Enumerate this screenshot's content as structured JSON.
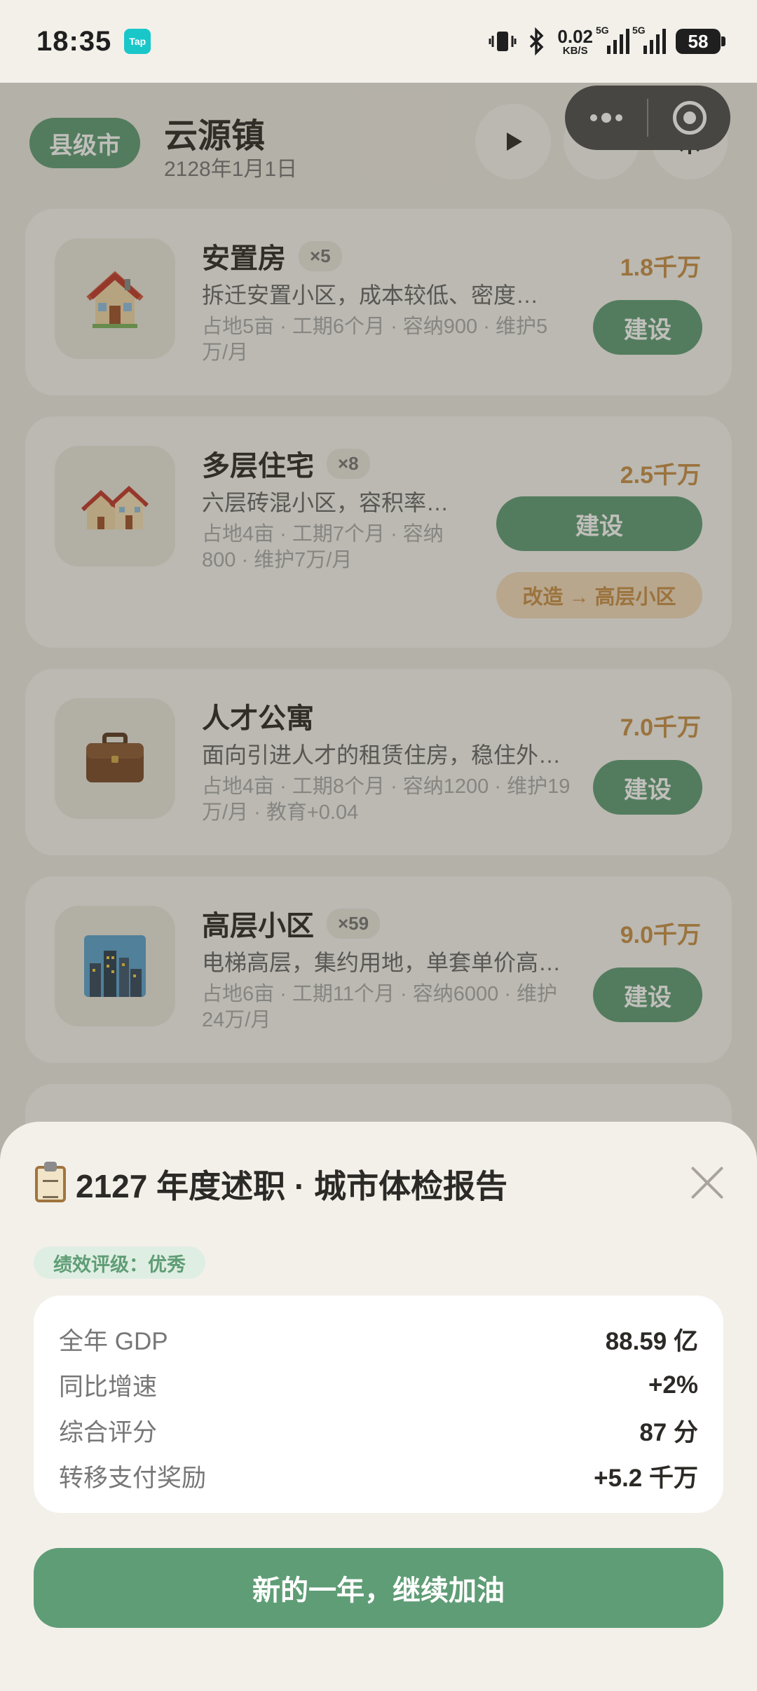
{
  "status_bar": {
    "time": "18:35",
    "app_badge": "Tap",
    "net_speed": "0.02",
    "net_unit": "KB/S",
    "sim1": "5G",
    "sim2": "5G",
    "battery": "58"
  },
  "header": {
    "level": "县级市",
    "town": "云源镇",
    "date": "2128年1月1日",
    "play_icon": "play-icon",
    "speed": "4x",
    "settings_icon": "gear-icon"
  },
  "buildings": [
    {
      "name": "安置房",
      "count": "×5",
      "desc": "拆迁安置小区，成本较低、密度…",
      "meta": "占地5亩 · 工期6个月 · 容纳900 · 维护5万/月",
      "price": "1.8千万",
      "build": "建设",
      "icon": "house-icon"
    },
    {
      "name": "多层住宅",
      "count": "×8",
      "desc": "六层砖混小区，容积率中…",
      "meta": "占地4亩 · 工期7个月 · 容纳800 · 维护7万/月",
      "price": "2.5千万",
      "build": "建设",
      "upgrade": "改造 → 高层小区",
      "icon": "houses-icon"
    },
    {
      "name": "人才公寓",
      "count": "",
      "desc": "面向引进人才的租赁住房，稳住外…",
      "meta": "占地4亩 · 工期8个月 · 容纳1200 · 维护19万/月 · 教育+0.04",
      "price": "7.0千万",
      "build": "建设",
      "icon": "briefcase-icon"
    },
    {
      "name": "高层小区",
      "count": "×59",
      "desc": "电梯高层，集约用地，单套单价高…",
      "meta": "占地6亩 · 工期11个月 · 容纳6000 · 维护24万/月",
      "price": "9.0千万",
      "build": "建设",
      "icon": "cityscape-icon"
    }
  ],
  "report": {
    "title": "2127 年度述职 · 城市体检报告",
    "rating": "绩效评级：优秀",
    "rows": [
      {
        "label": "全年 GDP",
        "value": "88.59 亿"
      },
      {
        "label": "同比增速",
        "value": "+2%"
      },
      {
        "label": "综合评分",
        "value": "87 分"
      },
      {
        "label": "转移支付奖励",
        "value": "+5.2 千万"
      }
    ],
    "cta": "新的一年，继续加油"
  },
  "colors": {
    "accent": "#5f9d76",
    "price": "#c99048",
    "background": "#f3f0ea"
  }
}
